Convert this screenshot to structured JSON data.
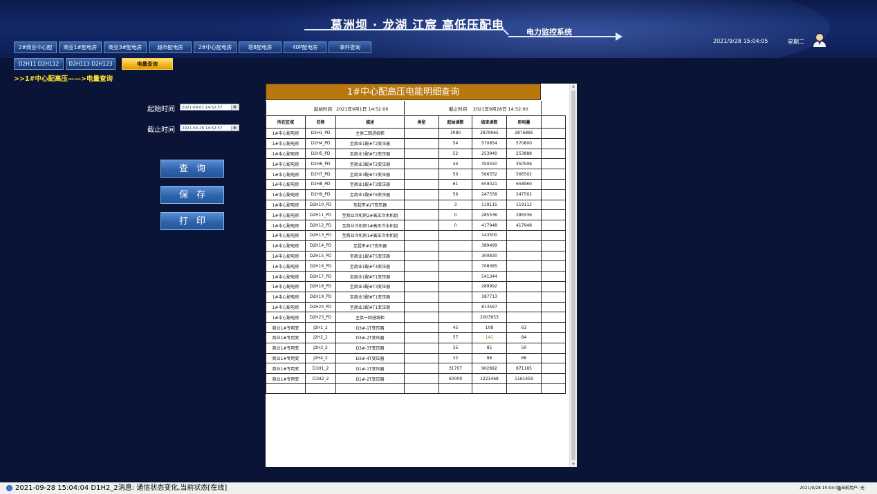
{
  "header": {
    "title": "葛洲坝 · 龙湖 江宸 高低压配电",
    "subtitle": "电力监控系统",
    "datetime": "2021/9/28 15:04:05",
    "weekday": "星期二",
    "avatar_icon": "user-avatar-icon"
  },
  "nav_tabs": [
    {
      "label": "2#商业中心配"
    },
    {
      "label": "商业1#配电房"
    },
    {
      "label": "商业3#配电房"
    },
    {
      "label": "超市配电房"
    },
    {
      "label": "2#中心配电房"
    },
    {
      "label": "塔8配电房"
    },
    {
      "label": "40P配电房"
    },
    {
      "label": "事件查询"
    }
  ],
  "sub_tabs": [
    {
      "label": "D2H11 D2H112"
    },
    {
      "label": "D2H113 D2H123"
    },
    {
      "label": "电量查询",
      "active": true
    }
  ],
  "breadcrumb": ">>1#中心配高压——>电量查询",
  "query_form": {
    "start_label": "起始时间",
    "start_value": "2021-09-01 14:52:57",
    "end_label": "截止时间",
    "end_value": "2021-09-28 14:52:57",
    "calendar_icon": "calendar-icon"
  },
  "actions": {
    "query": "查询",
    "save": "保存",
    "print": "打印"
  },
  "report": {
    "title": "1#中心配高压电能明细查询",
    "period_start_label": "起始时间",
    "period_start_value": "2021年9月1日 14:52:00",
    "period_end_label": "截止时间",
    "period_end_value": "2021年9月28日 14:52:00",
    "columns": [
      "所在区域",
      "名称",
      "描述",
      "类型",
      "起始读数",
      "结束读数",
      "用电量"
    ],
    "rows": [
      [
        "1#中心配电房",
        "D2H1_PD",
        "主供二回进线柜",
        "",
        "3080",
        "2879965",
        "2876885"
      ],
      [
        "1#中心配电房",
        "D2H4_PD",
        "至商业1配#T2变压器",
        "",
        "54",
        "570854",
        "570800"
      ],
      [
        "1#中心配电房",
        "D2H5_PD",
        "至商业3配#T2变压器",
        "",
        "52",
        "253940",
        "253888"
      ],
      [
        "1#中心配电房",
        "D2H6_PD",
        "至商业3配#T2变压器",
        "",
        "44",
        "350550",
        "350506"
      ],
      [
        "1#中心配电房",
        "D2H7_PD",
        "至商业3配#T2变压器",
        "",
        "50",
        "566552",
        "566502"
      ],
      [
        "1#中心配电房",
        "D2H8_PD",
        "至商业1配#T3变压器",
        "",
        "61",
        "659021",
        "658960"
      ],
      [
        "1#中心配电房",
        "D2H9_PD",
        "至商业1配#T6变压器",
        "",
        "56",
        "247558",
        "247502"
      ],
      [
        "1#中心配电房",
        "D2H10_PD",
        "至超市#2T变压器",
        "",
        "3",
        "119115",
        "119112"
      ],
      [
        "1#中心配电房",
        "D2H11_PD",
        "至商业冷机房2#高压冷水机组",
        "",
        "0",
        "285536",
        "285536"
      ],
      [
        "1#中心配电房",
        "D2H12_PD",
        "至商业冷机房1#高压冷水机组",
        "",
        "0",
        "417948",
        "417948"
      ],
      [
        "1#中心配电房",
        "D2H13_PD",
        "至商业冷机房1#高压冷水机组",
        "",
        "",
        "143500",
        ""
      ],
      [
        "1#中心配电房",
        "D2H14_PD",
        "至超市#1T变压器",
        "",
        "",
        "389499",
        ""
      ],
      [
        "1#中心配电房",
        "D2H15_PD",
        "至商业1配#T5变压器",
        "",
        "",
        "300830",
        ""
      ],
      [
        "1#中心配电房",
        "D2H16_PD",
        "至商业1配#T4变压器",
        "",
        "",
        "708085",
        ""
      ],
      [
        "1#中心配电房",
        "D2H17_PD",
        "至商业1配#T1变压器",
        "",
        "",
        "541344",
        ""
      ],
      [
        "1#中心配电房",
        "D2H18_PD",
        "至商业3配#T3变压器",
        "",
        "",
        "289992",
        ""
      ],
      [
        "1#中心配电房",
        "D2H19_PD",
        "至商业3配#T1变压器",
        "",
        "",
        "187713",
        ""
      ],
      [
        "1#中心配电房",
        "D2H20_PD",
        "至商业3配#T1变压器",
        "",
        "",
        "813597",
        ""
      ],
      [
        "1#中心配电房",
        "D2H23_PD",
        "主供一回进线柜",
        "",
        "",
        "2003953",
        ""
      ],
      [
        "商业1#专用变",
        "J2H1_2",
        "D3#-1T变压器",
        "",
        "45",
        "108",
        "63"
      ],
      [
        "商业1#专用变",
        "J2H2_2",
        "D3#-2T变压器",
        "",
        "57",
        "141",
        "84"
      ],
      [
        "商业1#专用变",
        "J2H3_2",
        "D3#-3T变压器",
        "",
        "35",
        "85",
        "50"
      ],
      [
        "商业1#专用变",
        "J2H4_2",
        "D3#-4T变压器",
        "",
        "32",
        "98",
        "66"
      ],
      [
        "商业1#专用变",
        "D1H1_2",
        "D1#-1T变压器",
        "",
        "31707",
        "902892",
        "871185"
      ],
      [
        "商业1#专用变",
        "D1H2_2",
        "D1#-2T变压器",
        "",
        "60009",
        "1221468",
        "1161459"
      ]
    ]
  },
  "statusbar": {
    "message": "2021-09-28 15:04:04  D1H2_2消息:  通信状态变化,当前状态[在线]",
    "time": "2021/9/28 15:04:05",
    "user": "当前用户: 无",
    "status_icon": "info-icon",
    "user_icon": "user-icon"
  }
}
